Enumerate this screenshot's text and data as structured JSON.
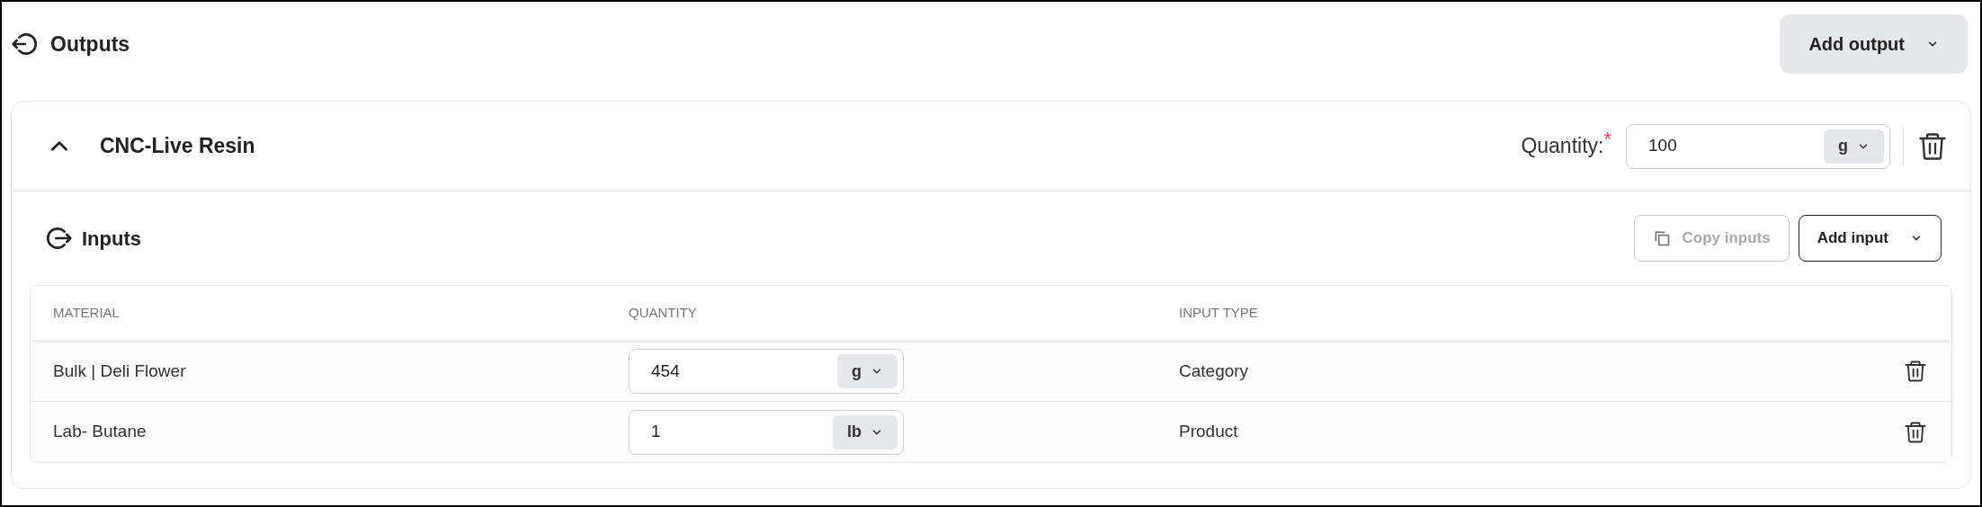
{
  "section": {
    "title": "Outputs",
    "add_button": "Add output"
  },
  "outputs": [
    {
      "name": "CNC-Live Resin",
      "expanded": true,
      "quantity_label": "Quantity:",
      "required_mark": "*",
      "quantity": "100",
      "unit": "g",
      "inputs": {
        "title": "Inputs",
        "copy_button": {
          "label": "Copy inputs",
          "disabled": true
        },
        "add_button": "Add input",
        "columns": [
          "MATERIAL",
          "QUANTITY",
          "INPUT TYPE"
        ],
        "rows": [
          {
            "material": "Bulk | Deli Flower",
            "quantity": "454",
            "unit": "g",
            "input_type": "Category"
          },
          {
            "material": "Lab- Butane",
            "quantity": "1",
            "unit": "lb",
            "input_type": "Product"
          }
        ]
      }
    }
  ]
}
